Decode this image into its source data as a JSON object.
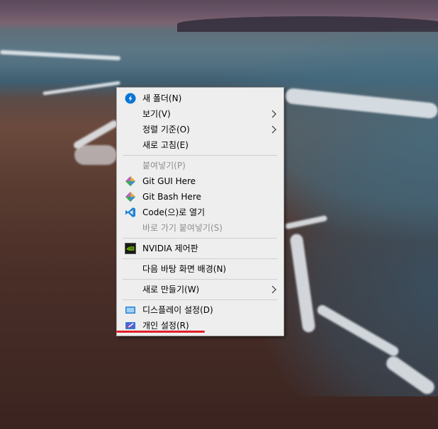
{
  "context_menu": {
    "items": [
      {
        "label": "새 폴더(N)",
        "icon": "new-folder-icon",
        "has_submenu": false,
        "disabled": false
      },
      {
        "label": "보기(V)",
        "icon": null,
        "has_submenu": true,
        "disabled": false
      },
      {
        "label": "정렬 기준(O)",
        "icon": null,
        "has_submenu": true,
        "disabled": false
      },
      {
        "label": "새로 고침(E)",
        "icon": null,
        "has_submenu": false,
        "disabled": false
      },
      {
        "label": "붙여넣기(P)",
        "icon": null,
        "has_submenu": false,
        "disabled": true
      },
      {
        "label": "Git GUI Here",
        "icon": "git-icon",
        "has_submenu": false,
        "disabled": false
      },
      {
        "label": "Git Bash Here",
        "icon": "git-icon",
        "has_submenu": false,
        "disabled": false
      },
      {
        "label": "Code(으)로 열기",
        "icon": "vscode-icon",
        "has_submenu": false,
        "disabled": false
      },
      {
        "label": "바로 가기 붙여넣기(S)",
        "icon": null,
        "has_submenu": false,
        "disabled": true
      },
      {
        "label": "NVIDIA 제어판",
        "icon": "nvidia-icon",
        "has_submenu": false,
        "disabled": false
      },
      {
        "label": "다음 바탕 화면 배경(N)",
        "icon": null,
        "has_submenu": false,
        "disabled": false
      },
      {
        "label": "새로 만들기(W)",
        "icon": null,
        "has_submenu": true,
        "disabled": false
      },
      {
        "label": "디스플레이 설정(D)",
        "icon": "display-icon",
        "has_submenu": false,
        "disabled": false
      },
      {
        "label": "개인 설정(R)",
        "icon": "personalize-icon",
        "has_submenu": false,
        "disabled": false
      }
    ]
  },
  "colors": {
    "menu_background": "#eeeeee",
    "highlight_underline": "#e0202a",
    "disabled_text": "#8f8f8f"
  }
}
